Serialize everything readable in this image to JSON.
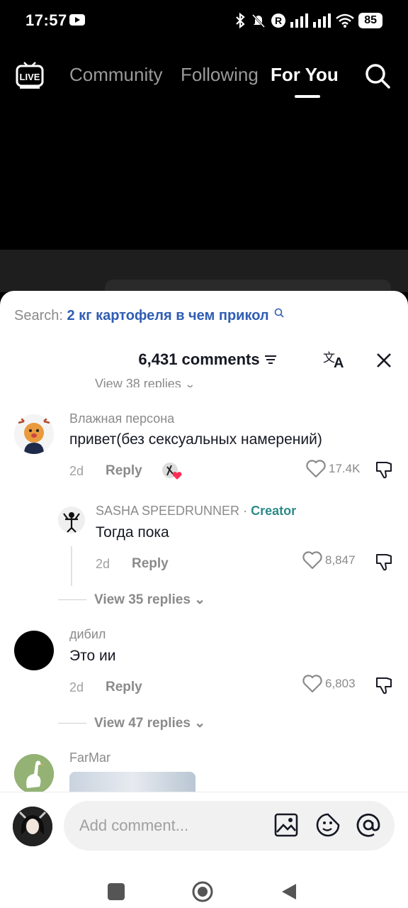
{
  "status_bar": {
    "time": "17:57",
    "battery": "85"
  },
  "nav": {
    "tabs": [
      "Community",
      "Following",
      "For You"
    ],
    "active": "For You",
    "live_label": "LIVE"
  },
  "comments_sheet": {
    "search_label": "Search:",
    "search_query": "2 кг картофеля в чем прикол",
    "count_label": "6,431 comments",
    "cut_text": "View 38 replies",
    "comments": [
      {
        "user": "Влажная персона",
        "text": "привет(без сексуальных намерений)",
        "age": "2d",
        "reply": "Reply",
        "likes": "17.4K"
      },
      {
        "user": "SASHA SPEEDRUNNER",
        "badge": "Creator",
        "separator": "·",
        "text": "Тогда пока",
        "age": "2d",
        "reply": "Reply",
        "likes": "8,847"
      },
      {
        "view_replies": "View 35 replies"
      },
      {
        "user": "дибил",
        "text": "Это ии",
        "age": "2d",
        "reply": "Reply",
        "likes": "6,803"
      },
      {
        "view_replies": "View 47 replies"
      },
      {
        "user": "FarMar"
      }
    ]
  },
  "input": {
    "placeholder": "Add comment..."
  },
  "colors": {
    "accent_blue": "#2f5db3",
    "creator": "#2d8a8a",
    "like_gray": "#8a8a8a"
  }
}
